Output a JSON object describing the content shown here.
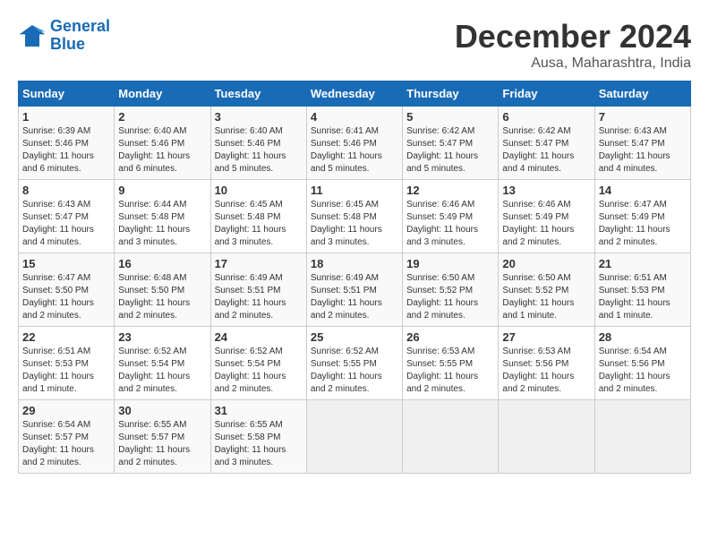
{
  "header": {
    "logo_line1": "General",
    "logo_line2": "Blue",
    "month_year": "December 2024",
    "location": "Ausa, Maharashtra, India"
  },
  "weekdays": [
    "Sunday",
    "Monday",
    "Tuesday",
    "Wednesday",
    "Thursday",
    "Friday",
    "Saturday"
  ],
  "weeks": [
    [
      {
        "day": "1",
        "sunrise": "6:39 AM",
        "sunset": "5:46 PM",
        "daylight": "11 hours and 6 minutes"
      },
      {
        "day": "2",
        "sunrise": "6:40 AM",
        "sunset": "5:46 PM",
        "daylight": "11 hours and 6 minutes"
      },
      {
        "day": "3",
        "sunrise": "6:40 AM",
        "sunset": "5:46 PM",
        "daylight": "11 hours and 5 minutes"
      },
      {
        "day": "4",
        "sunrise": "6:41 AM",
        "sunset": "5:46 PM",
        "daylight": "11 hours and 5 minutes"
      },
      {
        "day": "5",
        "sunrise": "6:42 AM",
        "sunset": "5:47 PM",
        "daylight": "11 hours and 5 minutes"
      },
      {
        "day": "6",
        "sunrise": "6:42 AM",
        "sunset": "5:47 PM",
        "daylight": "11 hours and 4 minutes"
      },
      {
        "day": "7",
        "sunrise": "6:43 AM",
        "sunset": "5:47 PM",
        "daylight": "11 hours and 4 minutes"
      }
    ],
    [
      {
        "day": "8",
        "sunrise": "6:43 AM",
        "sunset": "5:47 PM",
        "daylight": "11 hours and 4 minutes"
      },
      {
        "day": "9",
        "sunrise": "6:44 AM",
        "sunset": "5:48 PM",
        "daylight": "11 hours and 3 minutes"
      },
      {
        "day": "10",
        "sunrise": "6:45 AM",
        "sunset": "5:48 PM",
        "daylight": "11 hours and 3 minutes"
      },
      {
        "day": "11",
        "sunrise": "6:45 AM",
        "sunset": "5:48 PM",
        "daylight": "11 hours and 3 minutes"
      },
      {
        "day": "12",
        "sunrise": "6:46 AM",
        "sunset": "5:49 PM",
        "daylight": "11 hours and 3 minutes"
      },
      {
        "day": "13",
        "sunrise": "6:46 AM",
        "sunset": "5:49 PM",
        "daylight": "11 hours and 2 minutes"
      },
      {
        "day": "14",
        "sunrise": "6:47 AM",
        "sunset": "5:49 PM",
        "daylight": "11 hours and 2 minutes"
      }
    ],
    [
      {
        "day": "15",
        "sunrise": "6:47 AM",
        "sunset": "5:50 PM",
        "daylight": "11 hours and 2 minutes"
      },
      {
        "day": "16",
        "sunrise": "6:48 AM",
        "sunset": "5:50 PM",
        "daylight": "11 hours and 2 minutes"
      },
      {
        "day": "17",
        "sunrise": "6:49 AM",
        "sunset": "5:51 PM",
        "daylight": "11 hours and 2 minutes"
      },
      {
        "day": "18",
        "sunrise": "6:49 AM",
        "sunset": "5:51 PM",
        "daylight": "11 hours and 2 minutes"
      },
      {
        "day": "19",
        "sunrise": "6:50 AM",
        "sunset": "5:52 PM",
        "daylight": "11 hours and 2 minutes"
      },
      {
        "day": "20",
        "sunrise": "6:50 AM",
        "sunset": "5:52 PM",
        "daylight": "11 hours and 1 minute"
      },
      {
        "day": "21",
        "sunrise": "6:51 AM",
        "sunset": "5:53 PM",
        "daylight": "11 hours and 1 minute"
      }
    ],
    [
      {
        "day": "22",
        "sunrise": "6:51 AM",
        "sunset": "5:53 PM",
        "daylight": "11 hours and 1 minute"
      },
      {
        "day": "23",
        "sunrise": "6:52 AM",
        "sunset": "5:54 PM",
        "daylight": "11 hours and 2 minutes"
      },
      {
        "day": "24",
        "sunrise": "6:52 AM",
        "sunset": "5:54 PM",
        "daylight": "11 hours and 2 minutes"
      },
      {
        "day": "25",
        "sunrise": "6:52 AM",
        "sunset": "5:55 PM",
        "daylight": "11 hours and 2 minutes"
      },
      {
        "day": "26",
        "sunrise": "6:53 AM",
        "sunset": "5:55 PM",
        "daylight": "11 hours and 2 minutes"
      },
      {
        "day": "27",
        "sunrise": "6:53 AM",
        "sunset": "5:56 PM",
        "daylight": "11 hours and 2 minutes"
      },
      {
        "day": "28",
        "sunrise": "6:54 AM",
        "sunset": "5:56 PM",
        "daylight": "11 hours and 2 minutes"
      }
    ],
    [
      {
        "day": "29",
        "sunrise": "6:54 AM",
        "sunset": "5:57 PM",
        "daylight": "11 hours and 2 minutes"
      },
      {
        "day": "30",
        "sunrise": "6:55 AM",
        "sunset": "5:57 PM",
        "daylight": "11 hours and 2 minutes"
      },
      {
        "day": "31",
        "sunrise": "6:55 AM",
        "sunset": "5:58 PM",
        "daylight": "11 hours and 3 minutes"
      },
      null,
      null,
      null,
      null
    ]
  ]
}
